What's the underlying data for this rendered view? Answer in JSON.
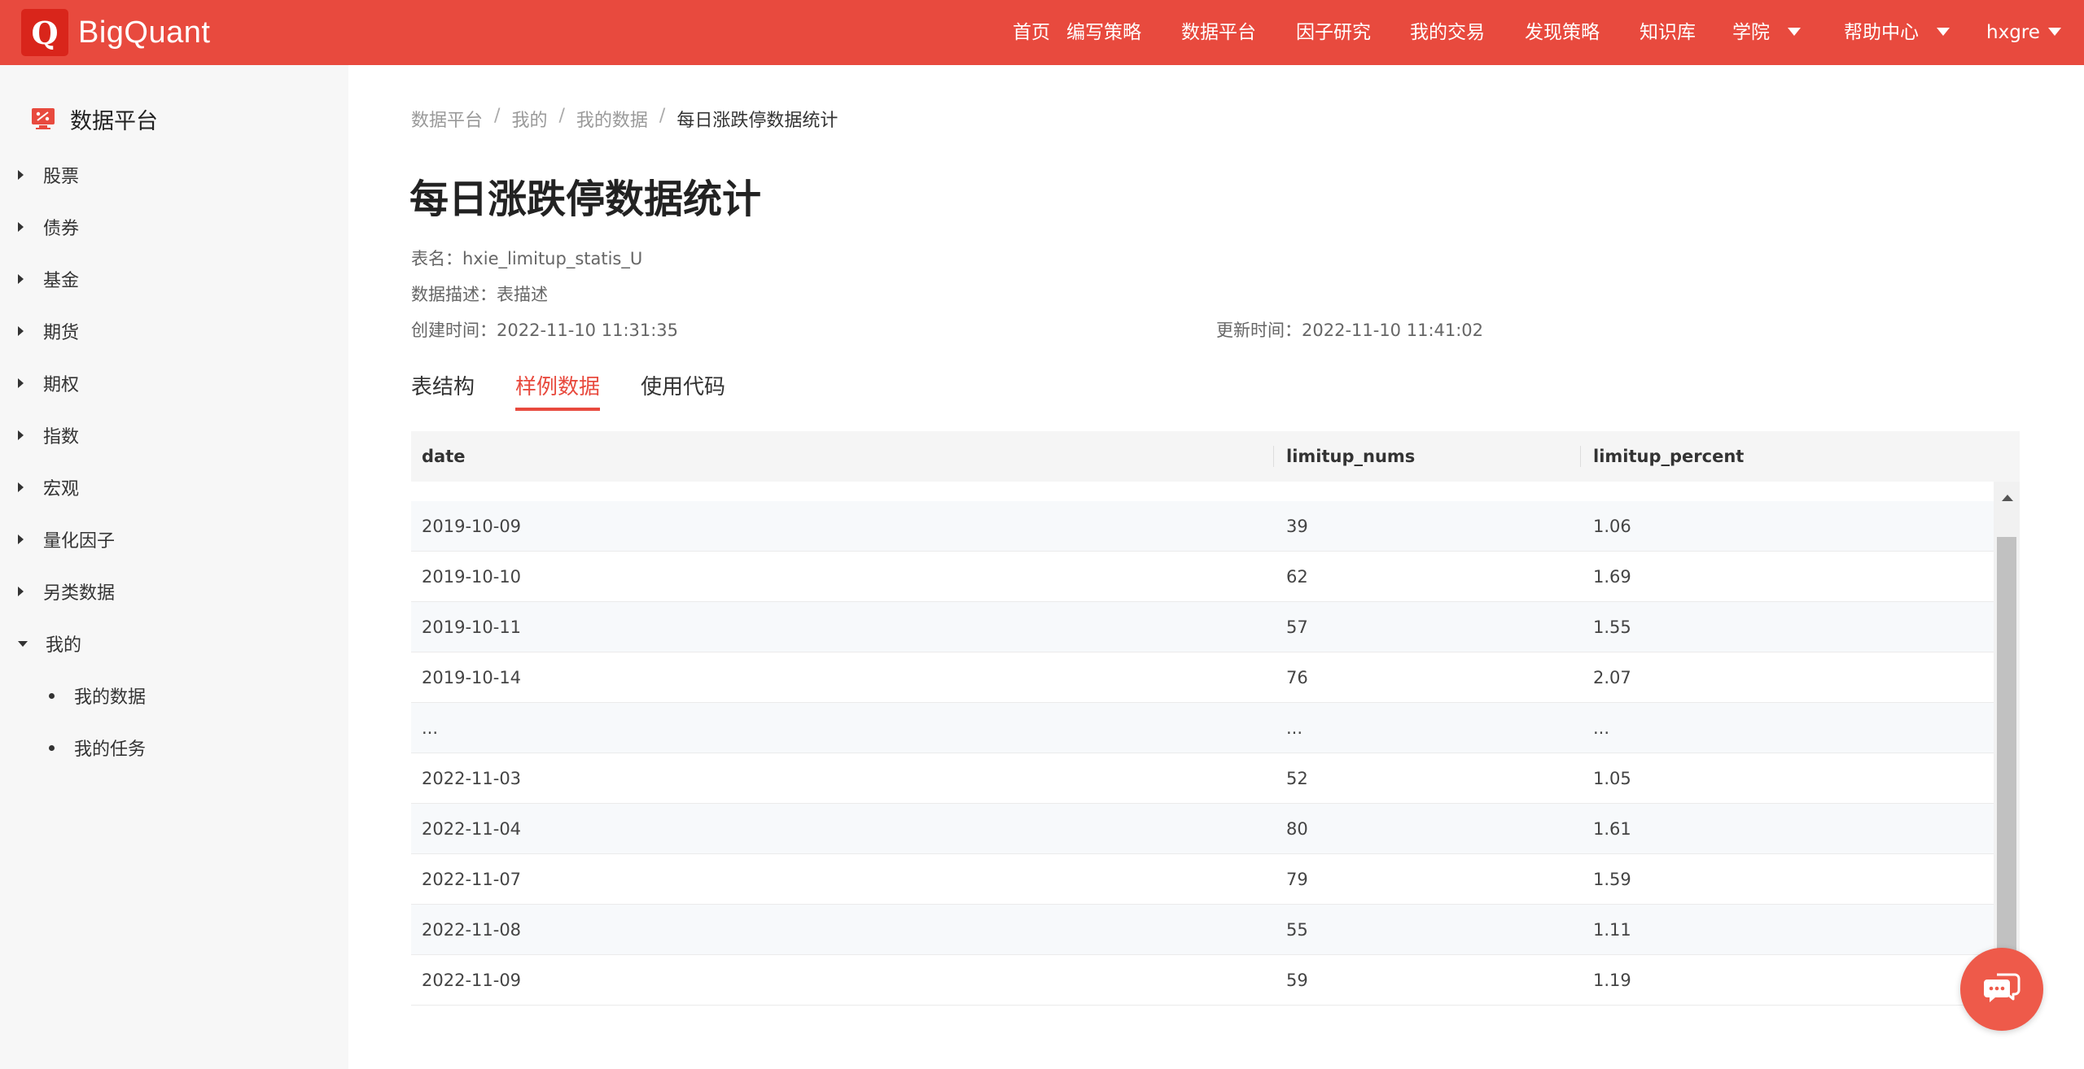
{
  "brand": {
    "logo_letter": "Q",
    "name": "BigQuant"
  },
  "nav": {
    "items": [
      {
        "label": "首页"
      },
      {
        "label": "编写策略"
      },
      {
        "label": "数据平台"
      },
      {
        "label": "因子研究"
      },
      {
        "label": "我的交易"
      },
      {
        "label": "发现策略"
      },
      {
        "label": "知识库"
      },
      {
        "label": "学院"
      },
      {
        "label": "帮助中心"
      },
      {
        "label": "hxgre"
      }
    ]
  },
  "sidebar": {
    "title": "数据平台",
    "items": [
      {
        "label": "股票"
      },
      {
        "label": "债券"
      },
      {
        "label": "基金"
      },
      {
        "label": "期货"
      },
      {
        "label": "期权"
      },
      {
        "label": "指数"
      },
      {
        "label": "宏观"
      },
      {
        "label": "量化因子"
      },
      {
        "label": "另类数据"
      },
      {
        "label": "我的"
      }
    ],
    "sub_items": [
      {
        "label": "我的数据"
      },
      {
        "label": "我的任务"
      }
    ]
  },
  "breadcrumb": {
    "items": [
      "数据平台",
      "我的",
      "我的数据"
    ],
    "current": "每日涨跌停数据统计",
    "separator": "/"
  },
  "page": {
    "title": "每日涨跌停数据统计",
    "table_name_label": "表名：",
    "table_name": "hxie_limitup_statis_U",
    "desc_label": "数据描述：",
    "desc": "表描述",
    "created_label": "创建时间：",
    "created": "2022-11-10 11:31:35",
    "updated_label": "更新时间：",
    "updated": "2022-11-10 11:41:02"
  },
  "tabs": [
    {
      "label": "表结构"
    },
    {
      "label": "样例数据"
    },
    {
      "label": "使用代码"
    }
  ],
  "table": {
    "columns": [
      "date",
      "limitup_nums",
      "limitup_percent"
    ],
    "rows": [
      [
        "2019-10-09",
        "39",
        "1.06"
      ],
      [
        "2019-10-10",
        "62",
        "1.69"
      ],
      [
        "2019-10-11",
        "57",
        "1.55"
      ],
      [
        "2019-10-14",
        "76",
        "2.07"
      ],
      [
        "...",
        "...",
        "..."
      ],
      [
        "2022-11-03",
        "52",
        "1.05"
      ],
      [
        "2022-11-04",
        "80",
        "1.61"
      ],
      [
        "2022-11-07",
        "79",
        "1.59"
      ],
      [
        "2022-11-08",
        "55",
        "1.11"
      ],
      [
        "2022-11-09",
        "59",
        "1.19"
      ]
    ]
  },
  "colors": {
    "accent": "#e84a3e",
    "sidebar_bg": "#f7f7f7"
  },
  "icons": {
    "chat": "chat-bubbles-icon",
    "data_platform": "monitor-icon"
  }
}
